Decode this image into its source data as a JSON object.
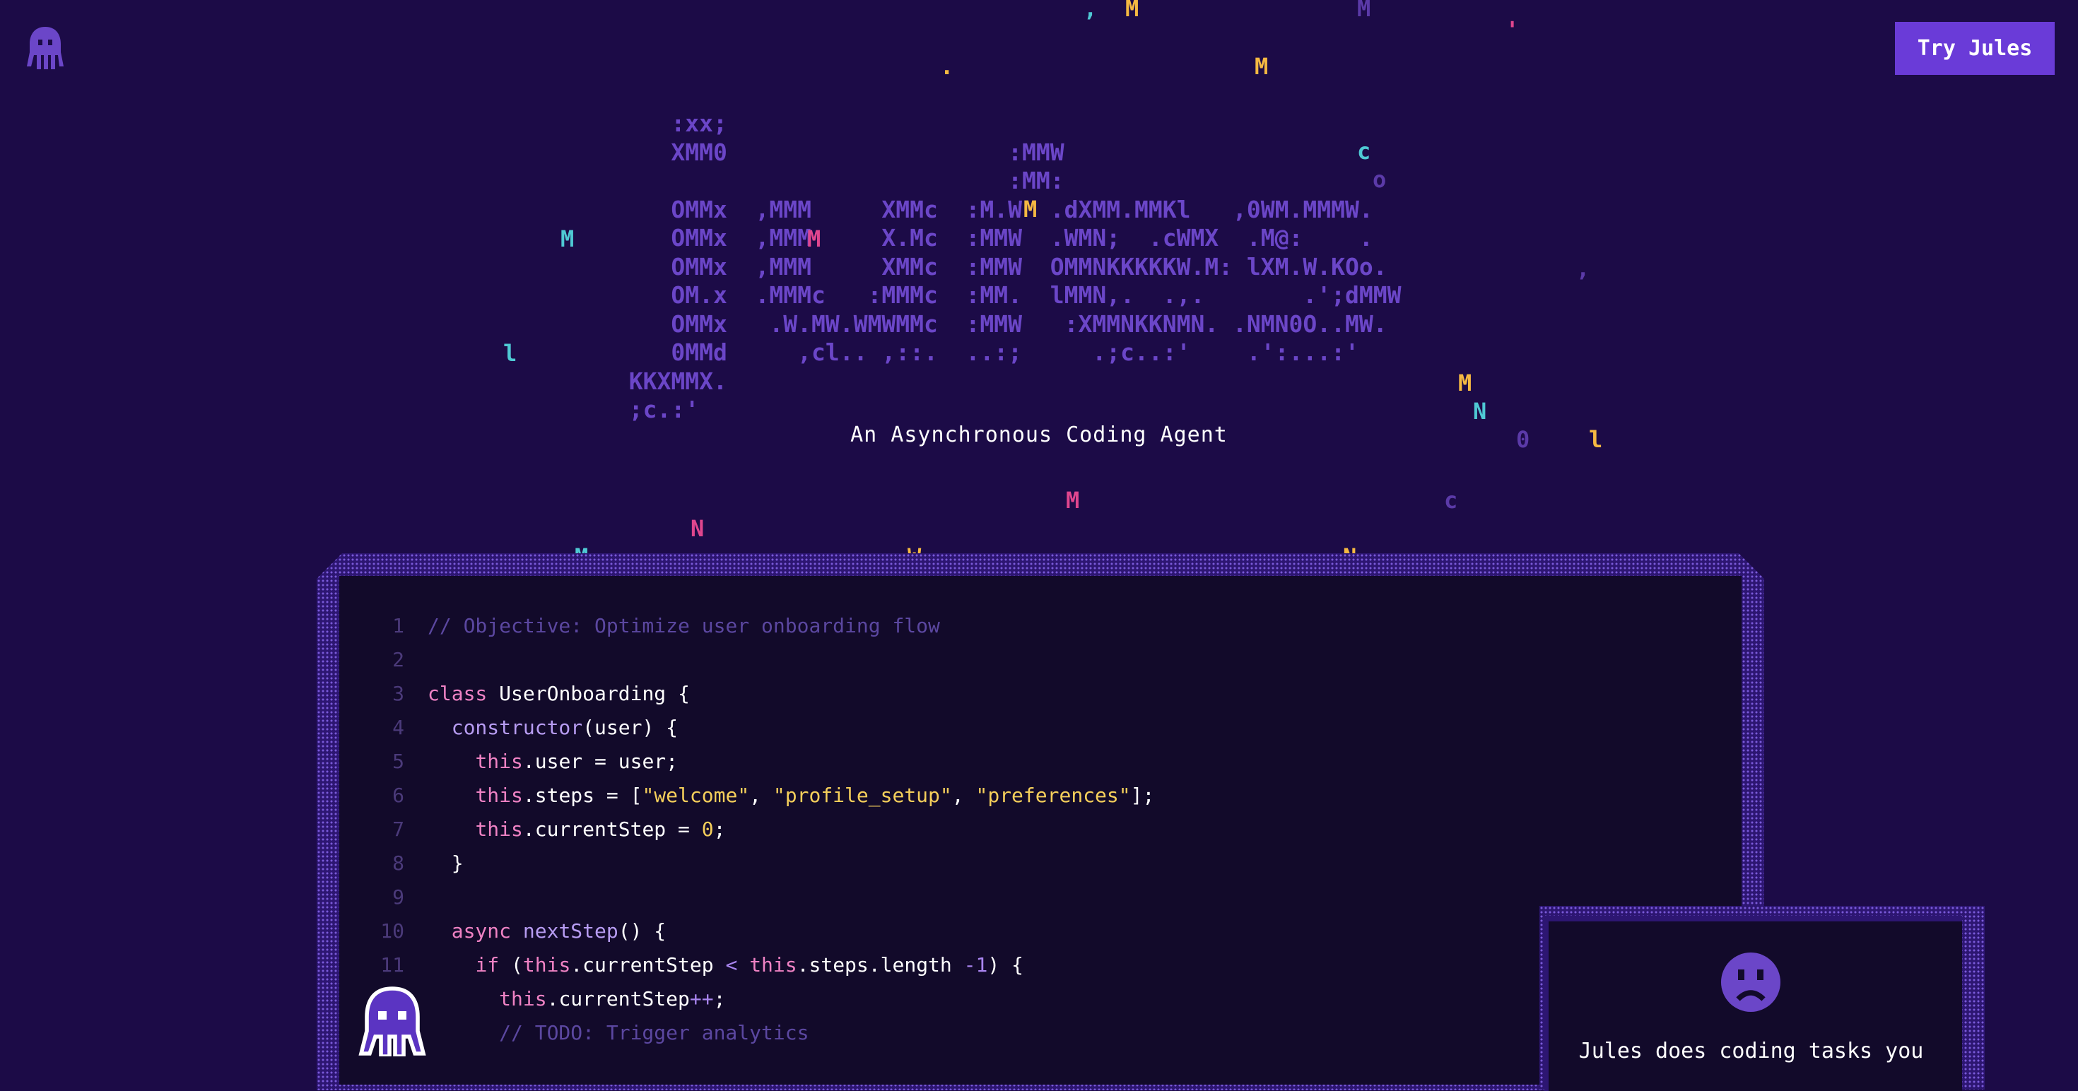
{
  "header": {
    "logo_icon": "octopus-icon",
    "cta_label": "Try Jules"
  },
  "hero": {
    "ascii_art": "     :xx;\n     XMM0                    :MMW\n                             :MM:\n     OMMx  ,MMM     XMMc  :M.W  .dXMM.MMKl   ,0WM.MMMW.\n     OMMx  ,MMM     X.Mc  :MMW  .WMN;  .cWMX  .M@:    .\n     OMMx  ,MMM     XMMc  :MMW  OMMNKKKKKW.M: lXM.W.KOo.\n     OM.x  .MMMc   :MMMc  :MM.  lMMN,.  .,.       .';dMMW\n     OMMx   .W.MW.WMWMMc  :MMW   :XMMNKKNMN. .NMN0O..MW.\n     0MMd     ,cl.. ,::.  ..:;     .;c..:'    .':...:'\n  KKXMMX.\n  ;c.:'",
    "tagline": "An Asynchronous Coding Agent",
    "floating_chars": [
      {
        "ch": ",",
        "color": "#4fc9d4"
      },
      {
        "ch": "M",
        "color": "#f5b942"
      },
      {
        "ch": "M",
        "color": "#5b3aa8"
      },
      {
        "ch": "'",
        "color": "#e0468e"
      },
      {
        "ch": ".",
        "color": "#f5b942"
      },
      {
        "ch": "M",
        "color": "#f5b942"
      },
      {
        "ch": "c",
        "color": "#4fc9d4"
      },
      {
        "ch": "o",
        "color": "#5b3aa8"
      },
      {
        "ch": "M",
        "color": "#f5b942"
      },
      {
        "ch": "M",
        "color": "#4fc9d4"
      },
      {
        "ch": "M",
        "color": "#e0468e"
      },
      {
        "ch": ",",
        "color": "#5b3aa8"
      },
      {
        "ch": "l",
        "color": "#4fc9d4"
      },
      {
        "ch": "M",
        "color": "#f5b942"
      },
      {
        "ch": "N",
        "color": "#4fc9d4"
      },
      {
        "ch": "0",
        "color": "#5b3aa8"
      },
      {
        "ch": "l",
        "color": "#f5b942"
      },
      {
        "ch": "M",
        "color": "#e0468e"
      },
      {
        "ch": "c",
        "color": "#5b3aa8"
      },
      {
        "ch": "N",
        "color": "#e0468e"
      },
      {
        "ch": "M",
        "color": "#4fc9d4"
      },
      {
        "ch": ",",
        "color": "#e0468e"
      },
      {
        "ch": "W",
        "color": "#f5b942"
      },
      {
        "ch": "N",
        "color": "#f5b942"
      }
    ]
  },
  "editor": {
    "lines": [
      {
        "n": "1",
        "parts": [
          {
            "t": "// Objective: Optimize user onboarding flow",
            "k": "comment"
          }
        ]
      },
      {
        "n": "2",
        "parts": []
      },
      {
        "n": "3",
        "parts": [
          {
            "t": "class ",
            "k": "kw"
          },
          {
            "t": "UserOnboarding",
            "k": "class"
          },
          {
            "t": " {",
            "k": "plain"
          }
        ]
      },
      {
        "n": "4",
        "parts": [
          {
            "t": "  ",
            "k": "plain"
          },
          {
            "t": "constructor",
            "k": "fn"
          },
          {
            "t": "(user) {",
            "k": "plain"
          }
        ]
      },
      {
        "n": "5",
        "parts": [
          {
            "t": "    ",
            "k": "plain"
          },
          {
            "t": "this",
            "k": "kw"
          },
          {
            "t": ".user = user;",
            "k": "plain"
          }
        ]
      },
      {
        "n": "6",
        "parts": [
          {
            "t": "    ",
            "k": "plain"
          },
          {
            "t": "this",
            "k": "kw"
          },
          {
            "t": ".steps = [",
            "k": "plain"
          },
          {
            "t": "\"welcome\"",
            "k": "str"
          },
          {
            "t": ", ",
            "k": "plain"
          },
          {
            "t": "\"profile_setup\"",
            "k": "str"
          },
          {
            "t": ", ",
            "k": "plain"
          },
          {
            "t": "\"preferences\"",
            "k": "str"
          },
          {
            "t": "];",
            "k": "plain"
          }
        ]
      },
      {
        "n": "7",
        "parts": [
          {
            "t": "    ",
            "k": "plain"
          },
          {
            "t": "this",
            "k": "kw"
          },
          {
            "t": ".currentStep = ",
            "k": "plain"
          },
          {
            "t": "0",
            "k": "num"
          },
          {
            "t": ";",
            "k": "plain"
          }
        ]
      },
      {
        "n": "8",
        "parts": [
          {
            "t": "  }",
            "k": "plain"
          }
        ]
      },
      {
        "n": "9",
        "parts": []
      },
      {
        "n": "10",
        "parts": [
          {
            "t": "  ",
            "k": "plain"
          },
          {
            "t": "async ",
            "k": "kw"
          },
          {
            "t": "nextStep",
            "k": "fn"
          },
          {
            "t": "() {",
            "k": "plain"
          }
        ]
      },
      {
        "n": "11",
        "parts": [
          {
            "t": "    ",
            "k": "plain"
          },
          {
            "t": "if ",
            "k": "kw"
          },
          {
            "t": "(",
            "k": "plain"
          },
          {
            "t": "this",
            "k": "kw"
          },
          {
            "t": ".currentStep ",
            "k": "plain"
          },
          {
            "t": "<",
            "k": "op"
          },
          {
            "t": " ",
            "k": "plain"
          },
          {
            "t": "this",
            "k": "kw"
          },
          {
            "t": ".steps.length ",
            "k": "plain"
          },
          {
            "t": "-1",
            "k": "op"
          },
          {
            "t": ") {",
            "k": "plain"
          }
        ]
      },
      {
        "n": "",
        "parts": [
          {
            "t": "      ",
            "k": "plain"
          },
          {
            "t": "this",
            "k": "kw"
          },
          {
            "t": ".currentStep",
            "k": "plain"
          },
          {
            "t": "++",
            "k": "op"
          },
          {
            "t": ";",
            "k": "plain"
          }
        ]
      },
      {
        "n": "",
        "parts": [
          {
            "t": "      // TODO: Trigger analytics",
            "k": "comment"
          }
        ]
      }
    ]
  },
  "card": {
    "icon": "sad-face-icon",
    "text": "Jules does coding tasks you"
  },
  "colors": {
    "background": "#1c0b47",
    "accent": "#6a3bd8",
    "editor_bg": "#120a2a"
  }
}
